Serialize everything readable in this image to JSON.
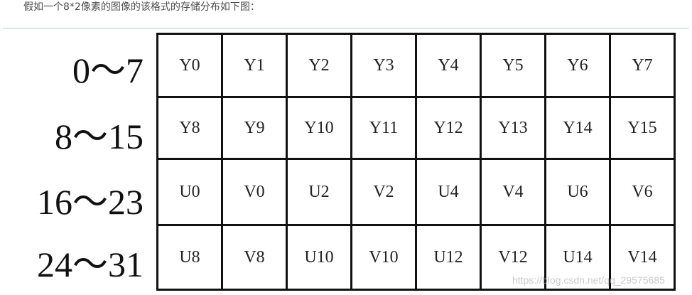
{
  "caption": "假如一个8*2像素的图像的该格式的存储分布如下图：",
  "figure": {
    "row_labels": [
      "0～7",
      "8～15",
      "16～23",
      "24～31"
    ],
    "rows": [
      [
        "Y0",
        "Y1",
        "Y2",
        "Y3",
        "Y4",
        "Y5",
        "Y6",
        "Y7"
      ],
      [
        "Y8",
        "Y9",
        "Y10",
        "Y11",
        "Y12",
        "Y13",
        "Y14",
        "Y15"
      ],
      [
        "U0",
        "V0",
        "U2",
        "V2",
        "U4",
        "V4",
        "U6",
        "V6"
      ],
      [
        "U8",
        "V8",
        "U10",
        "V10",
        "U12",
        "V12",
        "U14",
        "V14"
      ]
    ],
    "watermark": "https://blog.csdn.net/qq_29575685"
  }
}
